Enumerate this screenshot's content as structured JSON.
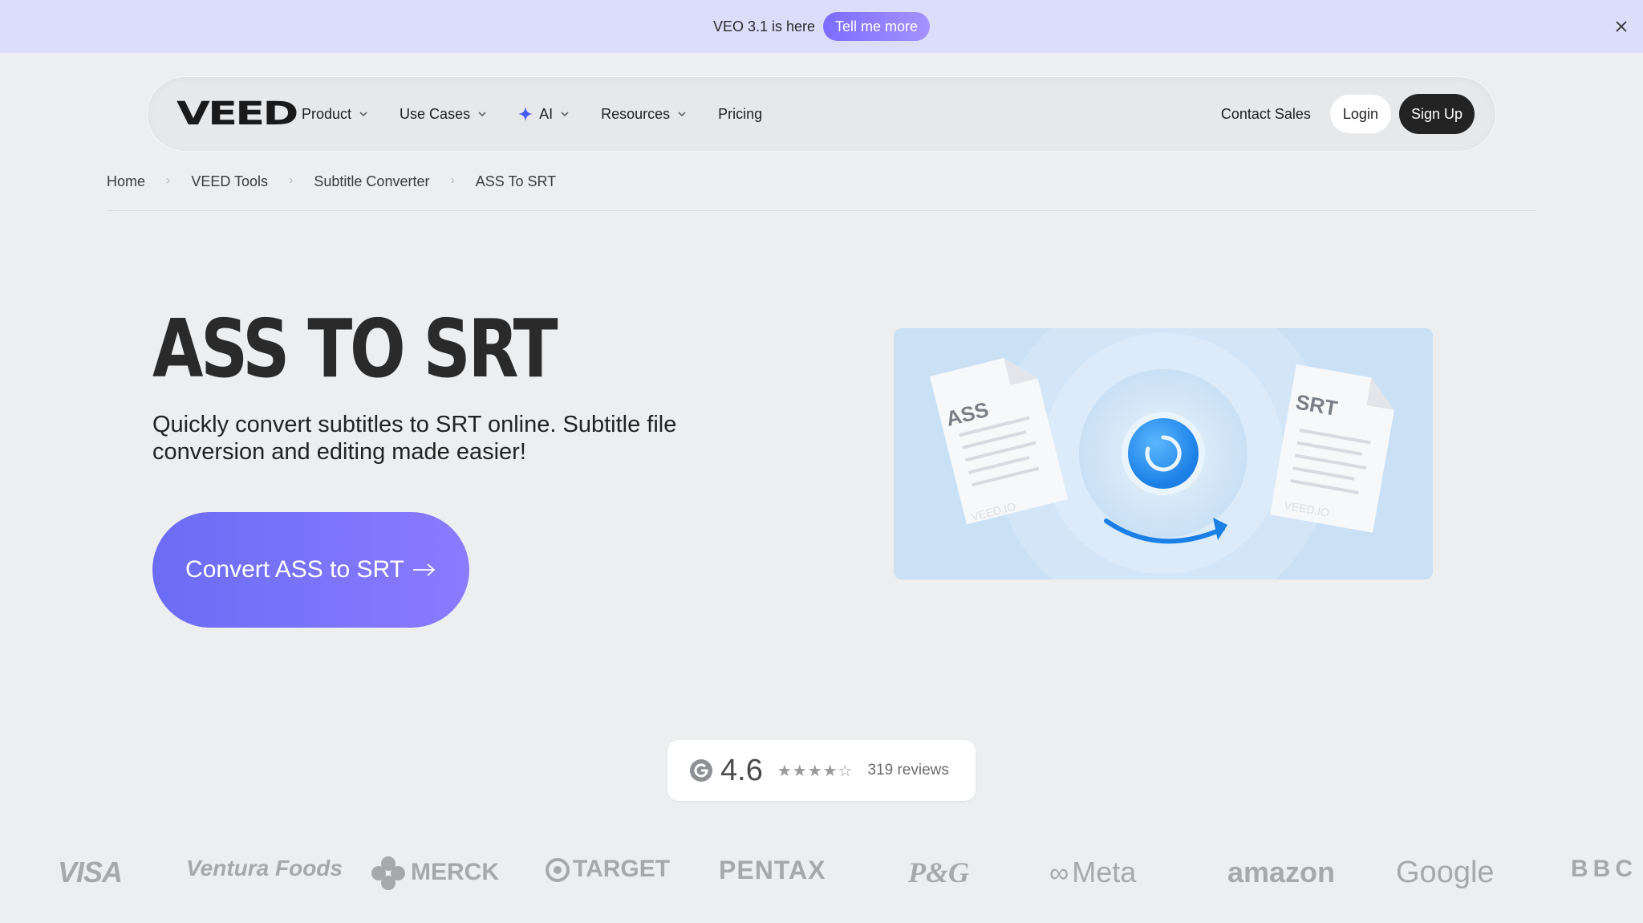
{
  "announcement": {
    "text": "VEO 3.1 is here",
    "button_label": "Tell me more"
  },
  "nav": {
    "logo": "VEED",
    "items": [
      {
        "label": "Product"
      },
      {
        "label": "Use Cases"
      },
      {
        "label": "AI"
      },
      {
        "label": "Resources"
      },
      {
        "label": "Pricing"
      }
    ],
    "contact": "Contact Sales",
    "login": "Login",
    "signup": "Sign Up"
  },
  "breadcrumb": [
    "Home",
    "VEED Tools",
    "Subtitle Converter",
    "ASS To SRT"
  ],
  "hero": {
    "title": "ASS TO SRT",
    "subtitle": "Quickly convert subtitles to SRT online. Subtitle file conversion and editing made easier!",
    "cta": "Convert ASS to SRT"
  },
  "illustration": {
    "left_doc_label": "ASS",
    "right_doc_label": "SRT",
    "watermark": "VEED.IO"
  },
  "rating": {
    "score": "4.6",
    "stars": "★★★★☆",
    "reviews": "319 reviews"
  },
  "logos": [
    "VISA",
    "Ventura Foods",
    "MERCK",
    "TARGET",
    "PENTAX",
    "P&G",
    "Meta",
    "amazon",
    "Google",
    "BBC"
  ],
  "colors": {
    "accent": "#7b6cff",
    "announce_bg": "#dcdcfb",
    "page_bg": "#eceef0"
  }
}
